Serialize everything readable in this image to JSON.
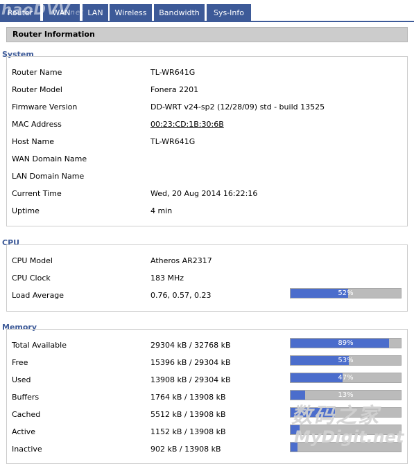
{
  "tabs": [
    {
      "label": "Router"
    },
    {
      "label": "WAN"
    },
    {
      "label": "LAN"
    },
    {
      "label": "Wireless"
    },
    {
      "label": "Bandwidth"
    },
    {
      "label": "Sys-Info"
    }
  ],
  "logo_watermark": "haoDVV",
  "logo_watermark_suffix": "net",
  "header": {
    "title": "Router Information"
  },
  "system": {
    "title": "System",
    "rows": [
      {
        "label": "Router Name",
        "value": "TL-WR641G"
      },
      {
        "label": "Router Model",
        "value": "Fonera 2201"
      },
      {
        "label": "Firmware Version",
        "value": "DD-WRT v24-sp2 (12/28/09) std - build 13525"
      },
      {
        "label": "MAC Address",
        "value": "00:23:CD:1B:30:6B"
      },
      {
        "label": "Host Name",
        "value": "TL-WR641G"
      },
      {
        "label": "WAN Domain Name",
        "value": ""
      },
      {
        "label": "LAN Domain Name",
        "value": ""
      },
      {
        "label": "Current Time",
        "value": "Wed, 20 Aug 2014 16:22:16"
      },
      {
        "label": "Uptime",
        "value": "4 min"
      }
    ]
  },
  "cpu": {
    "title": "CPU",
    "rows": [
      {
        "label": "CPU Model",
        "value": "Atheros AR2317"
      },
      {
        "label": "CPU Clock",
        "value": "183 MHz"
      },
      {
        "label": "Load Average",
        "value": "0.76, 0.57, 0.23",
        "percent": 52,
        "percent_label": "52%"
      }
    ]
  },
  "memory": {
    "title": "Memory",
    "rows": [
      {
        "label": "Total Available",
        "value": "29304 kB / 32768 kB",
        "percent": 89,
        "percent_label": "89%"
      },
      {
        "label": "Free",
        "value": "15396 kB / 29304 kB",
        "percent": 53,
        "percent_label": "53%"
      },
      {
        "label": "Used",
        "value": "13908 kB / 29304 kB",
        "percent": 47,
        "percent_label": "47%"
      },
      {
        "label": "Buffers",
        "value": "1764 kB / 13908 kB",
        "percent": 13,
        "percent_label": "13%"
      },
      {
        "label": "Cached",
        "value": "5512 kB / 13908 kB",
        "percent": 40,
        "percent_label": ""
      },
      {
        "label": "Active",
        "value": "1152 kB / 13908 kB",
        "percent": 8,
        "percent_label": ""
      },
      {
        "label": "Inactive",
        "value": "902 kB / 13908 kB",
        "percent": 6,
        "percent_label": ""
      }
    ]
  },
  "watermark": {
    "cn": "数码之家",
    "en": "MyDigit.net"
  },
  "colors": {
    "tab_bg": "#3d5a98",
    "bar_fill": "#4b6dcc",
    "bar_bg": "#bbbbbb",
    "section_title": "#3d5a98"
  }
}
